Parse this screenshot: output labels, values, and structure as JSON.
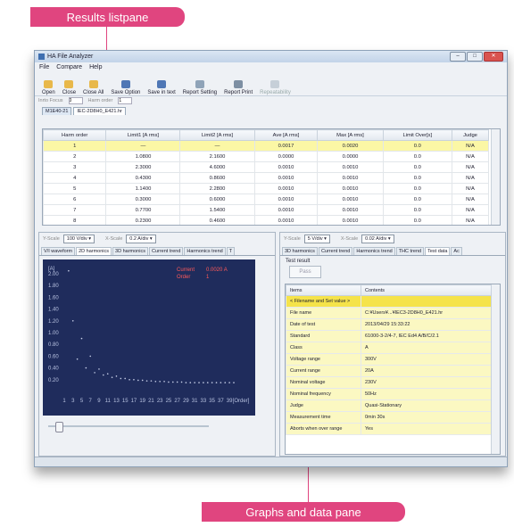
{
  "callouts": {
    "top": "Results listpane",
    "bottom": "Graphs and data pane"
  },
  "colors": {
    "callout": "#e0457f",
    "plot_bg": "#1f2c5c",
    "selected_row": "#fbf7a5",
    "group_row": "#f5e34a"
  },
  "window": {
    "title": "HA File Analyzer",
    "controls": [
      "minimize-icon",
      "maximize-icon",
      "close-icon"
    ]
  },
  "menu": [
    "File",
    "Compare",
    "Help"
  ],
  "toolbar": [
    {
      "label": "Open",
      "icon": "folder-open-icon"
    },
    {
      "label": "Close",
      "icon": "folder-close-icon"
    },
    {
      "label": "Close All",
      "icon": "folder-close-all-icon"
    },
    {
      "label": "Save Option",
      "icon": "save-option-icon"
    },
    {
      "label": "Save in text",
      "icon": "save-text-icon"
    },
    {
      "label": "Report Setting",
      "icon": "report-setting-icon"
    },
    {
      "label": "Report Print",
      "icon": "print-icon"
    },
    {
      "label": "Repeatability",
      "icon": "repeatability-icon"
    }
  ],
  "subbar": {
    "label1": "Inrto Focus",
    "value1": "0",
    "label2": "Harm order",
    "value2": "1"
  },
  "file_tabs": [
    "M1E40-21",
    "IEC-2D8H0_E421.hr"
  ],
  "results": {
    "columns": [
      "Harm order",
      "Limit1 [A rms]",
      "Limit2 [A rms]",
      "Ave [A rms]",
      "Max [A rms]",
      "Limit Over[s]",
      "Judge"
    ],
    "rows": [
      [
        "1",
        "—",
        "—",
        "0.0017",
        "0.0020",
        "0.0",
        "N/A"
      ],
      [
        "2",
        "1.0800",
        "2.1600",
        "0.0000",
        "0.0000",
        "0.0",
        "N/A"
      ],
      [
        "3",
        "2.3000",
        "4.6000",
        "0.0010",
        "0.0010",
        "0.0",
        "N/A"
      ],
      [
        "4",
        "0.4300",
        "0.8600",
        "0.0010",
        "0.0010",
        "0.0",
        "N/A"
      ],
      [
        "5",
        "1.1400",
        "2.2800",
        "0.0010",
        "0.0010",
        "0.0",
        "N/A"
      ],
      [
        "6",
        "0.3000",
        "0.6000",
        "0.0010",
        "0.0010",
        "0.0",
        "N/A"
      ],
      [
        "7",
        "0.7700",
        "1.5400",
        "0.0010",
        "0.0010",
        "0.0",
        "N/A"
      ],
      [
        "8",
        "0.2300",
        "0.4600",
        "0.0010",
        "0.0010",
        "0.0",
        "N/A"
      ]
    ]
  },
  "left_pane": {
    "ctrl1_label": "Y-Scale",
    "ctrl1_value": "100 V/div",
    "ctrl2_label": "X-Scale",
    "ctrl2_value": "0.2 A/div",
    "tabs": [
      "V/I waveform",
      "2D harmonics",
      "3D harmonics",
      "Current trend",
      "Harmonics trend",
      "T"
    ],
    "active_tab": 1,
    "legend": {
      "label1": "Current",
      "value1": "0.0020 A",
      "label2": "Order",
      "value2": "1"
    }
  },
  "chart_data": {
    "type": "scatter",
    "ylabel": "[A]",
    "xlabel": "[Order]",
    "ylim": [
      0,
      2.0
    ],
    "yticks": [
      "2.00",
      "1.80",
      "1.60",
      "1.40",
      "1.20",
      "1.00",
      "0.80",
      "0.60",
      "0.40",
      "0.20"
    ],
    "xticks": [
      "1",
      "3",
      "5",
      "7",
      "9",
      "11",
      "13",
      "15",
      "17",
      "19",
      "21",
      "23",
      "25",
      "27",
      "29",
      "31",
      "33",
      "35",
      "37",
      "39"
    ],
    "points": [
      [
        2,
        2.1
      ],
      [
        3,
        1.2
      ],
      [
        4,
        0.55
      ],
      [
        5,
        0.9
      ],
      [
        6,
        0.4
      ],
      [
        7,
        0.6
      ],
      [
        8,
        0.32
      ],
      [
        9,
        0.38
      ],
      [
        10,
        0.28
      ],
      [
        11,
        0.3
      ],
      [
        12,
        0.24
      ],
      [
        13,
        0.26
      ],
      [
        14,
        0.22
      ],
      [
        15,
        0.22
      ],
      [
        16,
        0.2
      ],
      [
        17,
        0.2
      ],
      [
        18,
        0.19
      ],
      [
        19,
        0.19
      ],
      [
        20,
        0.18
      ],
      [
        21,
        0.18
      ],
      [
        22,
        0.17
      ],
      [
        23,
        0.17
      ],
      [
        24,
        0.17
      ],
      [
        25,
        0.16
      ],
      [
        26,
        0.16
      ],
      [
        27,
        0.16
      ],
      [
        28,
        0.16
      ],
      [
        29,
        0.15
      ],
      [
        30,
        0.15
      ],
      [
        31,
        0.15
      ],
      [
        32,
        0.15
      ],
      [
        33,
        0.15
      ],
      [
        34,
        0.15
      ],
      [
        35,
        0.15
      ],
      [
        36,
        0.15
      ],
      [
        37,
        0.15
      ],
      [
        38,
        0.15
      ],
      [
        39,
        0.15
      ],
      [
        40,
        0.15
      ]
    ]
  },
  "right_pane": {
    "ctrl1_label": "Y-Scale",
    "ctrl1_value": "5 V/div",
    "ctrl2_label": "X-Scale",
    "ctrl2_value": "0.02 A/div",
    "tabs": [
      "3D harmonics",
      "Current trend",
      "Harmonics trend",
      "THC trend",
      "Test data",
      "Ac"
    ],
    "active_tab": 4,
    "test_result_label": "Test result",
    "test_result_value": "Pass",
    "columns": [
      "Items",
      "Contents"
    ],
    "rows": [
      {
        "item": "< Filename and Set value >",
        "content": "",
        "group": true
      },
      {
        "item": "File name",
        "content": "C:¥Users¥...¥IEC3-2D8H0_E421.hr",
        "group": false
      },
      {
        "item": "Date of test",
        "content": "2013/04/29 15:33:22",
        "group": false
      },
      {
        "item": "Standard",
        "content": "61000-3-2/4-7, IEC Ed4 A/B/C/2.1",
        "group": false
      },
      {
        "item": "Class",
        "content": "A",
        "group": false
      },
      {
        "item": "Voltage range",
        "content": "300V",
        "group": false
      },
      {
        "item": "Current range",
        "content": "20A",
        "group": false
      },
      {
        "item": "Nominal voltage",
        "content": "230V",
        "group": false
      },
      {
        "item": "Nominal frequency",
        "content": "50Hz",
        "group": false
      },
      {
        "item": "Judge",
        "content": "Quasi-Stationary",
        "group": false
      },
      {
        "item": "Measurement time",
        "content": "0min 30s",
        "group": false
      },
      {
        "item": "Aborts when over range",
        "content": "Yes",
        "group": false
      }
    ]
  }
}
